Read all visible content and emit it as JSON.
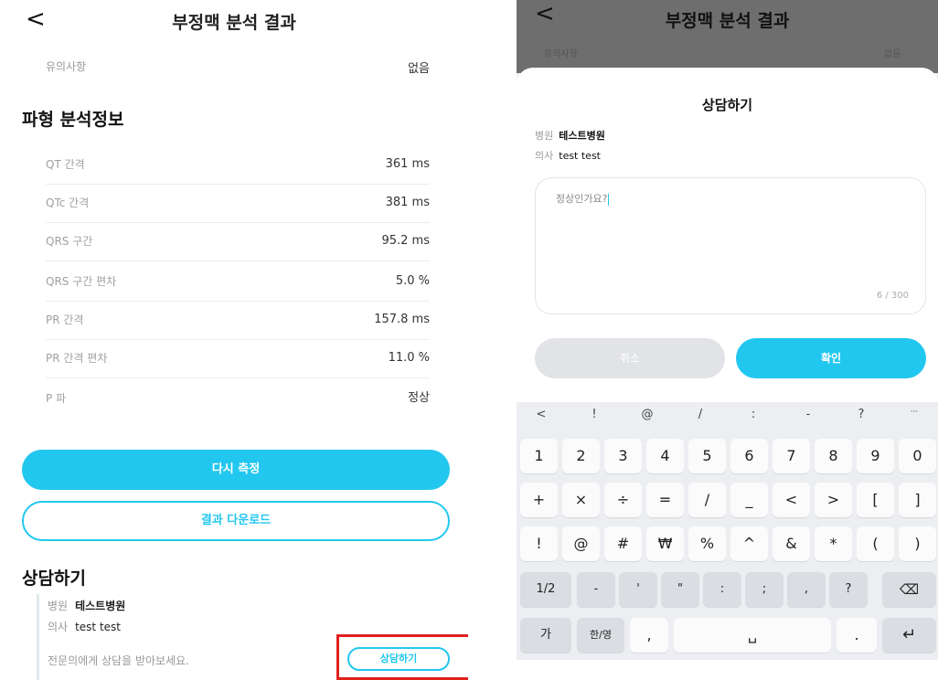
{
  "left": {
    "back_glyph": "<",
    "title": "부정맥 분석 결과",
    "note": {
      "label": "유의사항",
      "value": "없음"
    },
    "waveform_section_title": "파형 분석정보",
    "waveform_rows": [
      {
        "label": "QT 간격",
        "value": "361 ms"
      },
      {
        "label": "QTc 간격",
        "value": "381 ms"
      },
      {
        "label": "QRS 구간",
        "value": "95.2 ms"
      },
      {
        "label": "QRS 구간 편차",
        "value": "5.0 %"
      },
      {
        "label": "PR 간격",
        "value": "157.8 ms"
      },
      {
        "label": "PR 간격 편차",
        "value": "11.0 %"
      },
      {
        "label": "P 파",
        "value": "정상"
      }
    ],
    "remeasure_label": "다시 측정",
    "download_label": "결과 다운로드",
    "consult_section_title": "상담하기",
    "hospital_label": "병원",
    "hospital_value": "테스트병원",
    "doctor_label": "의사",
    "doctor_value": "test test",
    "consult_prompt": "전문의에게 상담을 받아보세요.",
    "consult_button_label": "상담하기"
  },
  "right": {
    "back_glyph": "<",
    "title": "부정맥 분석 결과",
    "dim_left": "유의사항",
    "dim_right": "없음",
    "sheet_title": "상담하기",
    "hospital_label": "병원",
    "hospital_value": "테스트병원",
    "doctor_label": "의사",
    "doctor_value": "test test",
    "message_text": "정상인가요?",
    "char_count": "6 / 300",
    "cancel_label": "취소",
    "confirm_label": "확인"
  },
  "keyboard": {
    "symbols": [
      "<",
      "!",
      "@",
      "/",
      ":",
      "-",
      "?",
      "···"
    ],
    "row1": [
      "1",
      "2",
      "3",
      "4",
      "5",
      "6",
      "7",
      "8",
      "9",
      "0"
    ],
    "row2": [
      "+",
      "×",
      "÷",
      "=",
      "/",
      "_",
      "<",
      ">",
      "[",
      "]"
    ],
    "row3": [
      "!",
      "@",
      "#",
      "₩",
      "%",
      "^",
      "&",
      "*",
      "(",
      ")"
    ],
    "row4": [
      "1/2",
      "-",
      "'",
      "\"",
      ":",
      ";",
      ",",
      "?",
      "⌫"
    ],
    "row5": [
      "가",
      "한/영",
      ",",
      "␣",
      ".",
      "↵"
    ]
  },
  "colors": {
    "accent": "#22c7ef",
    "highlight": "#e0201e"
  }
}
